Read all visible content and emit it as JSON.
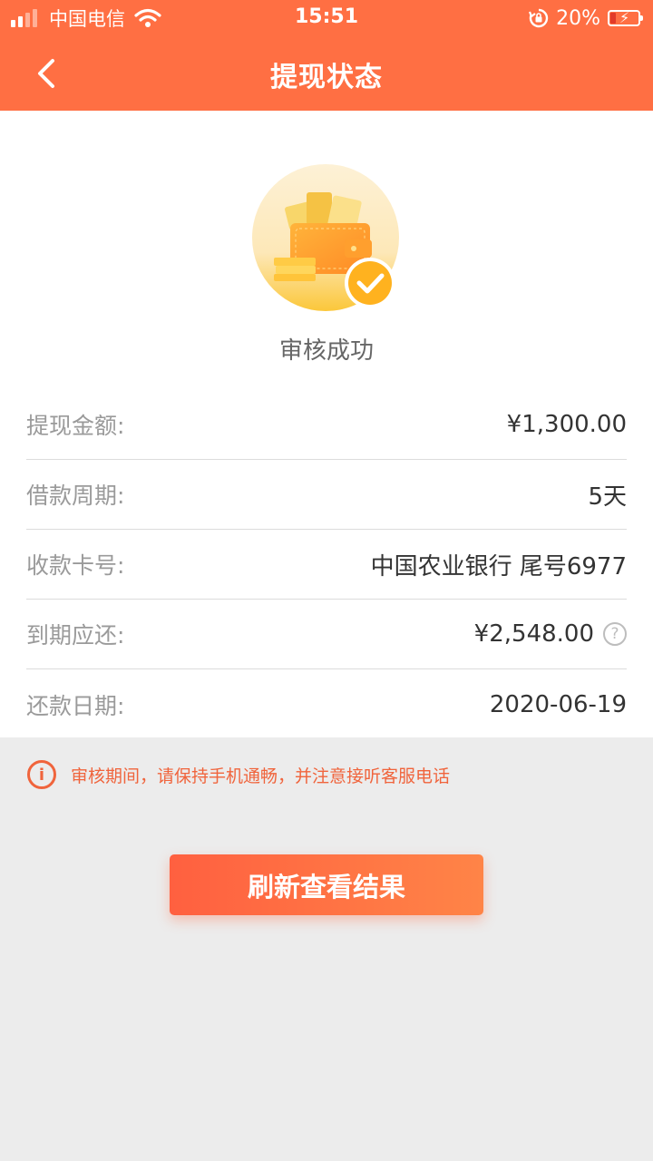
{
  "status_bar": {
    "carrier": "中国电信",
    "time": "15:51",
    "battery_percent": "20%",
    "battery_level": 0.2
  },
  "header": {
    "title": "提现状态",
    "background_color": "#ff6f43"
  },
  "status": {
    "text": "审核成功"
  },
  "details": [
    {
      "label": "提现金额:",
      "value": "¥1,300.00"
    },
    {
      "label": "借款周期:",
      "value": "5天"
    },
    {
      "label": "收款卡号:",
      "value": "中国农业银行 尾号6977"
    },
    {
      "label": "到期应还:",
      "value": "¥2,548.00",
      "help_icon": "question-circle-icon"
    },
    {
      "label": "还款日期:",
      "value": "2020-06-19"
    }
  ],
  "notice": {
    "icon": "info-circle-icon",
    "text": "审核期间，请保持手机通畅，并注意接听客服电话"
  },
  "actions": {
    "refresh_label": "刷新查看结果"
  },
  "colors": {
    "accent": "#ff6f43",
    "notice": "#f0643c"
  }
}
